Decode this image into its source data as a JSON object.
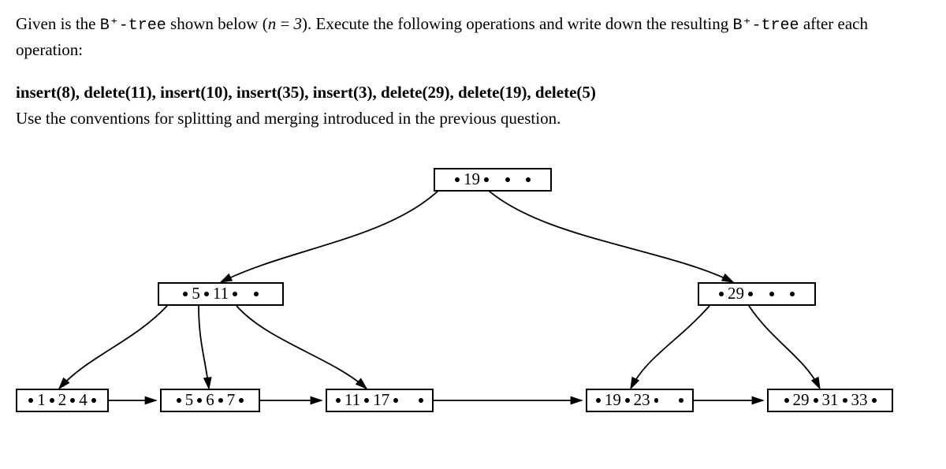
{
  "intro": {
    "prefix": "Given is the ",
    "btree": "B⁺-tree",
    "mid1": " shown below (",
    "n_var": "n",
    "eq": " = ",
    "n_val": "3",
    "mid2": "). Execute the following operations and write down the resulting ",
    "btree2": "B⁺-tree",
    "suffix": " after each operation:"
  },
  "operations": "insert(8), delete(11), insert(10), insert(35), insert(3), delete(29), delete(19), delete(5)",
  "convention": "Use the conventions for splitting and merging introduced in the previous question.",
  "tree": {
    "root": {
      "keys": [
        "19"
      ],
      "slots": 3
    },
    "internal": [
      {
        "keys": [
          "5",
          "11"
        ],
        "slots": 3
      },
      {
        "keys": [
          "29"
        ],
        "slots": 3
      }
    ],
    "leaves": [
      {
        "keys": [
          "1",
          "2",
          "4"
        ]
      },
      {
        "keys": [
          "5",
          "6",
          "7"
        ]
      },
      {
        "keys": [
          "11",
          "17"
        ]
      },
      {
        "keys": [
          "19",
          "23"
        ]
      },
      {
        "keys": [
          "29",
          "31",
          "33"
        ]
      }
    ]
  }
}
